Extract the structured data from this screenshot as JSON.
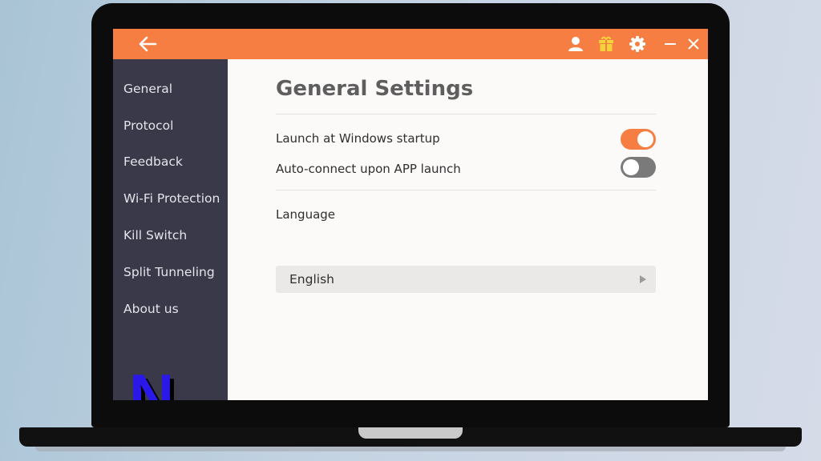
{
  "colors": {
    "accent": "#f67e42",
    "sidebar_bg": "#3a3949",
    "content_bg": "#fcfaf9",
    "toggle_off": "#7a7a7a",
    "logo_blue": "#2a18e8"
  },
  "titlebar": {
    "icons": [
      "back-arrow-icon",
      "user-icon",
      "gift-icon",
      "gear-icon",
      "minimize-icon",
      "close-icon"
    ]
  },
  "sidebar": {
    "items": [
      {
        "label": "General"
      },
      {
        "label": "Protocol"
      },
      {
        "label": "Feedback"
      },
      {
        "label": "Wi-Fi Protection"
      },
      {
        "label": "Kill Switch"
      },
      {
        "label": "Split Tunneling"
      },
      {
        "label": "About us"
      }
    ],
    "logo_letter": "N"
  },
  "main": {
    "title": "General Settings",
    "settings": [
      {
        "label": "Launch at Windows startup",
        "enabled": true
      },
      {
        "label": "Auto-connect upon APP launch",
        "enabled": false
      }
    ],
    "language": {
      "label": "Language",
      "selected": "English"
    }
  }
}
